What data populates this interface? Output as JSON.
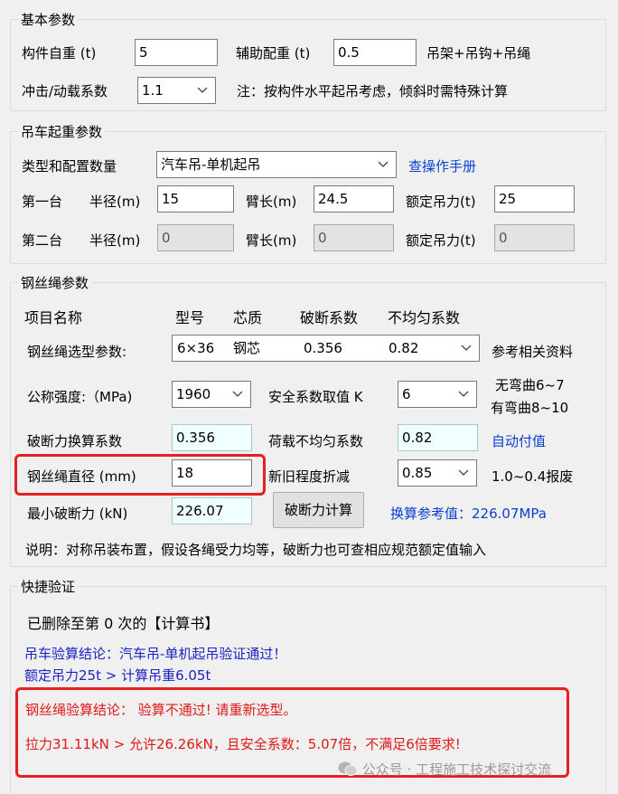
{
  "basic": {
    "title": "基本参数",
    "weight_label": "构件自重 (t)",
    "weight_value": "5",
    "aux_label": "辅助配重 (t)",
    "aux_value": "0.5",
    "aux_note": "吊架+吊钩+吊绳",
    "impact_label": "冲击/动载系数",
    "impact_value": "1.1",
    "note": "注：按构件水平起吊考虑，倾斜时需特殊计算"
  },
  "crane": {
    "title": "吊车起重参数",
    "type_label": "类型和配置数量",
    "type_value": "汽车吊-单机起吊",
    "manual_link": "查操作手册",
    "first_label": "第一台",
    "second_label": "第二台",
    "radius_label": "半径(m)",
    "boom_label": "臂长(m)",
    "rated_label": "额定吊力(t)",
    "first": {
      "radius": "15",
      "boom": "24.5",
      "rated": "25"
    },
    "second": {
      "radius": "0",
      "boom": "0",
      "rated": "0"
    }
  },
  "rope": {
    "title": "钢丝绳参数",
    "headers": {
      "item": "项目名称",
      "model": "型号",
      "core": "芯质",
      "break_coef": "破断系数",
      "uneven_coef": "不均匀系数"
    },
    "select_label": "钢丝绳选型参数:",
    "select_value": {
      "model": "6×36",
      "core": "钢芯",
      "break_coef": "0.356",
      "uneven_coef": "0.82"
    },
    "ref_note": "参考相关资料",
    "strength_label": "公称强度:（MPa)",
    "strength_value": "1960",
    "safety_label": "安全系数取值 K",
    "safety_value": "6",
    "safety_note1": "无弯曲6~7",
    "safety_note2": "有弯曲8~10",
    "break_conv_label": "破断力换算系数",
    "break_conv_value": "0.356",
    "load_uneven_label": "荷载不均匀系数",
    "load_uneven_value": "0.82",
    "auto_link": "自动付值",
    "diameter_label": "钢丝绳直径 (mm)",
    "diameter_value": "18",
    "wear_label": "新旧程度折减",
    "wear_value": "0.85",
    "wear_note": "1.0~0.4报废",
    "min_break_label": "最小破断力 (kN)",
    "min_break_value": "226.07",
    "calc_button": "破断力计算",
    "ref_value": "换算参考值：226.07MPa",
    "desc": "说明：对称吊装布置，假设各绳受力均等，破断力也可查相应规范额定值输入"
  },
  "verify": {
    "title": "快捷验证",
    "deleted": "已删除至第 0 次的【计算书】",
    "crane_result_1": "吊车验算结论：汽车吊-单机起吊验证通过！",
    "crane_result_2": "额定吊力25t > 计算吊重6.05t",
    "rope_result_1": "钢丝绳验算结论：  验算不通过! 请重新选型。",
    "rope_result_2": "拉力31.11kN > 允许26.26kN，且安全系数：5.07倍，不满足6倍要求!"
  },
  "watermark": "公众号 · 工程施工技术探讨交流",
  "colors": {
    "highlight_red": "#e52020",
    "link_blue": "#0a3fd1",
    "result_blue": "#1a22c4",
    "fail_red": "#e01818"
  }
}
